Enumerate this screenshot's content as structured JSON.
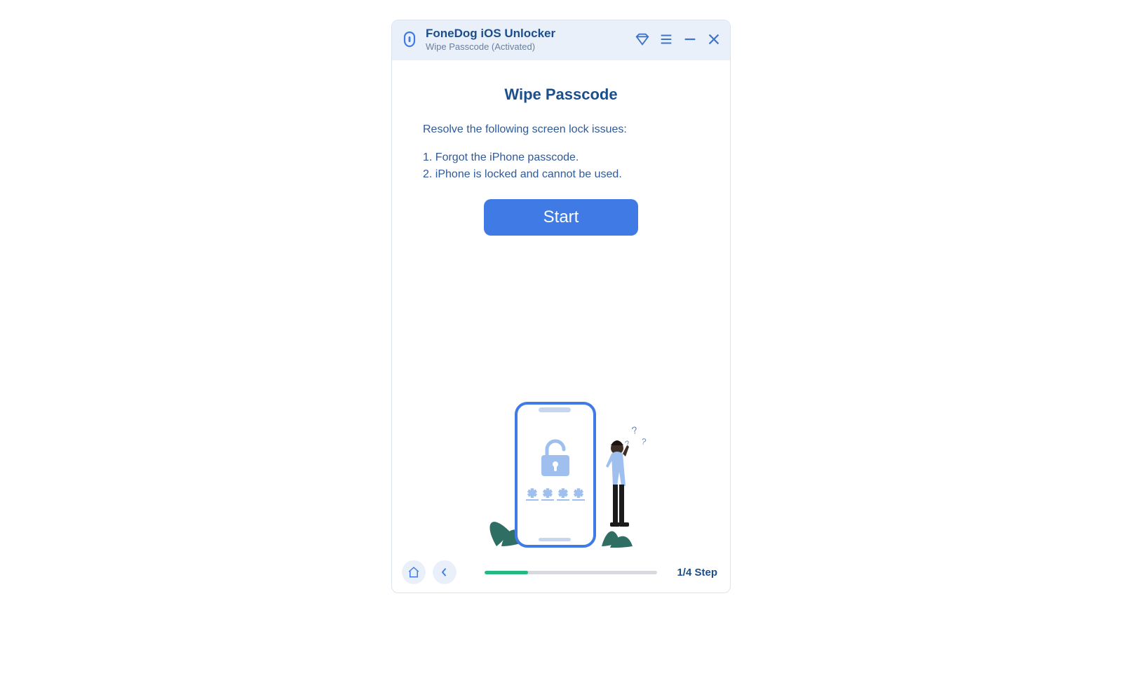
{
  "titlebar": {
    "app_name": "FoneDog iOS Unlocker",
    "subtitle": "Wipe Passcode  (Activated)"
  },
  "main": {
    "heading": "Wipe Passcode",
    "lead": "Resolve the following screen lock issues:",
    "issues": [
      "1. Forgot the iPhone passcode.",
      "2. iPhone is locked and cannot be used."
    ],
    "start_label": "Start"
  },
  "footer": {
    "step_label": "1/4 Step",
    "progress_percent": 25
  }
}
